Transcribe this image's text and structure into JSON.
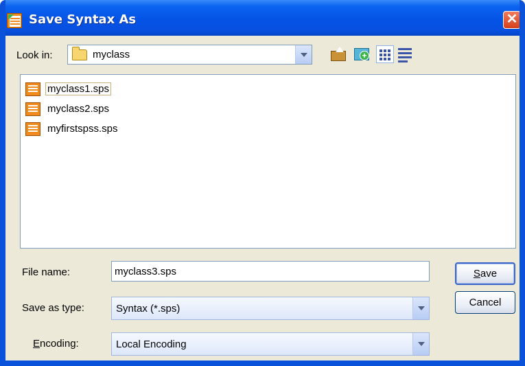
{
  "window": {
    "title": "Save Syntax As",
    "close_glyph": "✕"
  },
  "toolbar": {
    "look_in_label": "Look in:",
    "look_in_value": "myclass",
    "icons": [
      "up-one-level-icon",
      "create-new-folder-icon",
      "list-view-icon",
      "details-view-icon"
    ]
  },
  "files": [
    {
      "name": "myclass1.sps",
      "icon": "syntax-file-icon",
      "focused": true
    },
    {
      "name": "myclass2.sps",
      "icon": "syntax-file-icon",
      "focused": false
    },
    {
      "name": "myfirstspss.sps",
      "icon": "syntax-file-icon",
      "focused": false
    }
  ],
  "form": {
    "file_name_label": "File name:",
    "file_name_value": "myclass3.sps",
    "save_as_type_label": "Save as type:",
    "save_as_type_value": "Syntax (*.sps)",
    "encoding_label_first": "E",
    "encoding_label_rest": "ncoding:",
    "encoding_value": "Local Encoding"
  },
  "buttons": {
    "save_first": "S",
    "save_rest": "ave",
    "cancel": "Cancel"
  },
  "colors": {
    "titlebar": "#0553e6",
    "dialog_bg": "#ece9d8",
    "close": "#d6401c",
    "file_icon": "#f08a1c"
  }
}
